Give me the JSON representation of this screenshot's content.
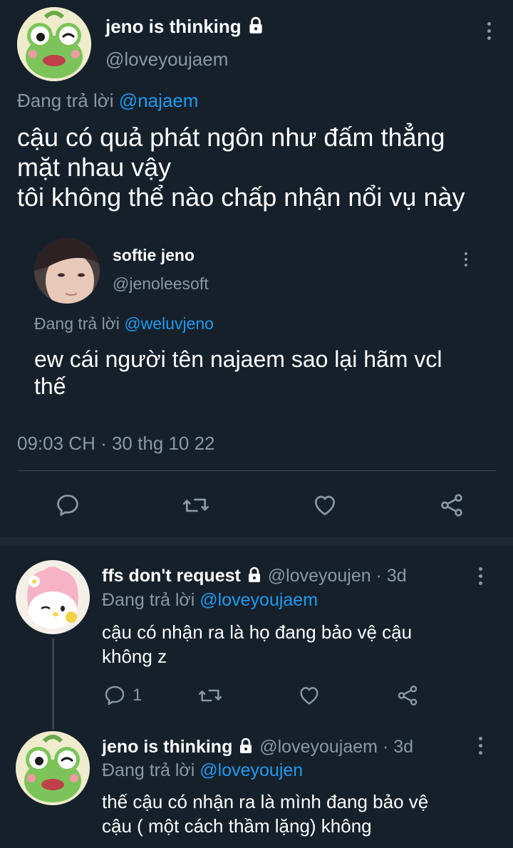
{
  "main_tweet": {
    "display_name": "jeno is thinking",
    "handle": "@loveyoujaem",
    "reply_prefix": "Đang trả lời",
    "reply_to": "@najaem",
    "text_lines": [
      "cậu có quả phát ngôn như đấm thẳng",
      "mặt nhau vậy",
      "tôi không thể nào chấp nhận nổi vụ này"
    ],
    "timestamp": "09:03 CH · 30 thg 10 22"
  },
  "quoted_tweet": {
    "display_name": "softie jeno",
    "handle": "@jenoleesoft",
    "reply_prefix": "Đang trả lời",
    "reply_to": "@weluvjeno",
    "text_lines": [
      "ew cái người tên najaem sao lại hãm vcl",
      "thế"
    ]
  },
  "actions": {
    "reply_icon": "reply-icon",
    "retweet_icon": "retweet-icon",
    "like_icon": "heart-icon",
    "share_icon": "share-icon"
  },
  "replies": [
    {
      "display_name": "ffs don't request",
      "handle": "@loveyoujen",
      "age": "· 3d",
      "reply_prefix": "Đang trả lời",
      "reply_to": "@loveyoujaem",
      "text_lines": [
        "cậu có nhận ra là họ đang bảo vệ cậu",
        "không z"
      ],
      "reply_count": "1"
    },
    {
      "display_name": "jeno is thinking",
      "handle": "@loveyoujaem",
      "age": "· 3d",
      "reply_prefix": "Đang trả lời",
      "reply_to": "@loveyoujen",
      "text_lines": [
        "thế cậu có nhận ra là mình đang bảo vệ",
        "cậu ( một cách thầm lặng) không"
      ]
    }
  ],
  "colors": {
    "background": "#15202b",
    "muted": "#8b98a5",
    "link": "#1d9bf0"
  }
}
